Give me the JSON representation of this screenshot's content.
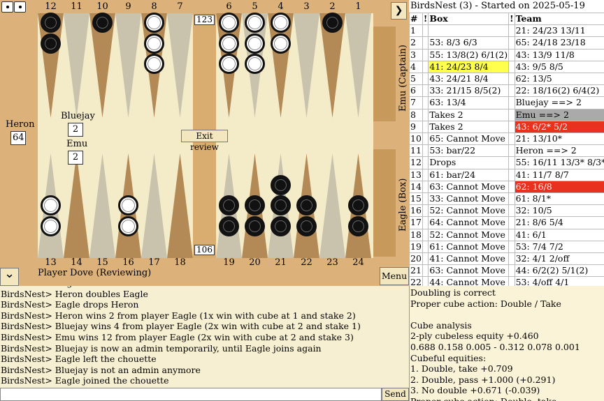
{
  "board": {
    "top_point_labels": [
      "12",
      "11",
      "10",
      "9",
      "8",
      "7",
      "6",
      "5",
      "4",
      "3",
      "2",
      "1"
    ],
    "bottom_point_labels": [
      "13",
      "14",
      "15",
      "16",
      "17",
      "18",
      "19",
      "20",
      "21",
      "22",
      "23",
      "24"
    ],
    "bar_top_pip": "123",
    "bar_bottom_pip": "106",
    "heron_label": "Heron",
    "heron_score": "64",
    "bluejay_label": "Bluejay",
    "bluejay_score": "2",
    "emu_label": "Emu",
    "emu_score": "2",
    "exit_review_label": "Exit review",
    "player_label": "Player Dove (Reviewing)",
    "menu_label": "Menu",
    "emu_side_label": "Emu (Captain)",
    "eagle_side_label": "Eagle (Box)",
    "chevron_right": "❯",
    "chevron_down": "⌄",
    "dice_icon": "double-die-icon"
  },
  "movelist": {
    "title": "BirdsNest (3) - Started on 2025-05-19",
    "headers": [
      "#",
      "!",
      "Box",
      "!",
      "Team"
    ],
    "rows": [
      {
        "n": "1",
        "box": "",
        "team": "21: 24/23 13/11",
        "box_hl": "",
        "team_hl": ""
      },
      {
        "n": "2",
        "box": "53: 8/3 6/3",
        "team": "65: 24/18 23/18",
        "box_hl": "",
        "team_hl": ""
      },
      {
        "n": "3",
        "box": "55: 13/8(2) 6/1(2)",
        "team": "43: 13/9 11/8",
        "box_hl": "",
        "team_hl": ""
      },
      {
        "n": "4",
        "box": "41: 24/23 8/4",
        "team": "43: 9/5 8/5",
        "box_hl": "hl-y",
        "team_hl": ""
      },
      {
        "n": "5",
        "box": "43: 24/21 8/4",
        "team": "62: 13/5",
        "box_hl": "",
        "team_hl": ""
      },
      {
        "n": "6",
        "box": "33: 21/15 8/5(2)",
        "team": "22: 18/16(2) 6/4(2)",
        "box_hl": "",
        "team_hl": ""
      },
      {
        "n": "7",
        "box": "63: 13/4",
        "team": "Bluejay ==> 2",
        "box_hl": "",
        "team_hl": ""
      },
      {
        "n": "8",
        "box": "Takes 2",
        "team": "Emu ==> 2",
        "box_hl": "",
        "team_hl": "hl-g"
      },
      {
        "n": "9",
        "box": "Takes 2",
        "team": "43: 6/2* 5/2",
        "box_hl": "",
        "team_hl": "hl-r"
      },
      {
        "n": "10",
        "box": "65: Cannot Move",
        "team": "21: 13/10*",
        "box_hl": "",
        "team_hl": ""
      },
      {
        "n": "11",
        "box": "53: bar/22",
        "team": "Heron ==> 2",
        "box_hl": "",
        "team_hl": ""
      },
      {
        "n": "12",
        "box": "Drops",
        "team": "55: 16/11 13/3* 8/3*",
        "box_hl": "",
        "team_hl": ""
      },
      {
        "n": "13",
        "box": "61: bar/24",
        "team": "41: 11/7 8/7",
        "box_hl": "",
        "team_hl": ""
      },
      {
        "n": "14",
        "box": "63: Cannot Move",
        "team": "62: 16/8",
        "box_hl": "",
        "team_hl": "hl-r"
      },
      {
        "n": "15",
        "box": "33: Cannot Move",
        "team": "61: 8/1*",
        "box_hl": "",
        "team_hl": ""
      },
      {
        "n": "16",
        "box": "52: Cannot Move",
        "team": "32: 10/5",
        "box_hl": "",
        "team_hl": ""
      },
      {
        "n": "17",
        "box": "64: Cannot Move",
        "team": "21: 8/6 5/4",
        "box_hl": "",
        "team_hl": ""
      },
      {
        "n": "18",
        "box": "52: Cannot Move",
        "team": "41: 6/1",
        "box_hl": "",
        "team_hl": ""
      },
      {
        "n": "19",
        "box": "61: Cannot Move",
        "team": "53: 7/4 7/2",
        "box_hl": "",
        "team_hl": ""
      },
      {
        "n": "20",
        "box": "41: Cannot Move",
        "team": "32: 4/1 2/off",
        "box_hl": "",
        "team_hl": ""
      },
      {
        "n": "21",
        "box": "63: Cannot Move",
        "team": "44: 6/2(2) 5/1(2)",
        "box_hl": "",
        "team_hl": ""
      },
      {
        "n": "22",
        "box": "44: Cannot Move",
        "team": "53: 4/off 4/1",
        "box_hl": "",
        "team_hl": ""
      }
    ]
  },
  "chat": {
    "lines": [
      "BirdsNest> Eagle takes Emu",
      "BirdsNest> Heron doubles Eagle",
      "BirdsNest> Eagle drops Heron",
      "BirdsNest> Heron wins 2 from player Eagle (1x win with cube at 1 and stake 2)",
      "BirdsNest> Bluejay wins 4 from player Eagle (2x win with cube at 2 and stake 1)",
      "BirdsNest> Emu wins 12 from player Eagle (2x win with cube at 2 and stake 3)",
      "BirdsNest> Bluejay is now an admin temporarily, until Eagle joins again",
      "BirdsNest> Eagle left the chouette",
      "BirdsNest> Bluejay is not an admin anymore",
      "BirdsNest> Eagle joined the chouette"
    ],
    "input_value": "",
    "send_label": "Send"
  },
  "analysis": {
    "lines": [
      "Doubling is correct",
      "Proper cube action: Double / Take",
      "",
      "Cube analysis",
      "2-ply cubeless equity +0.460",
      "0.688 0.158 0.005 - 0.312 0.078 0.001",
      "Cubeful equities:",
      "1. Double, take +0.709",
      "2. Double, pass +1.000 (+0.291)",
      "3. No double +0.671 (-0.039)",
      "Proper cube action: Double, take"
    ]
  },
  "colors": {
    "board_frame": "#dcb27a",
    "field": "#f4ebc9",
    "point_dark": "#b38a55",
    "point_light": "#c9c2ad",
    "highlight_yellow": "#ffff4d",
    "highlight_red": "#e8311e",
    "highlight_gray": "#aaaaaa"
  }
}
